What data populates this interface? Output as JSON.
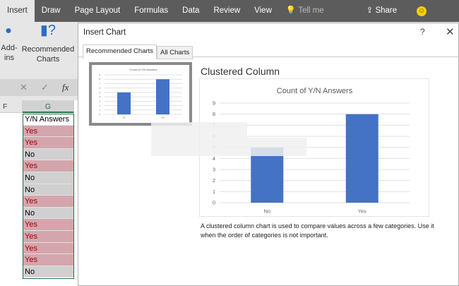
{
  "ribbon_tabs": [
    "Insert",
    "Draw",
    "Page Layout",
    "Formulas",
    "Data",
    "Review",
    "View"
  ],
  "tell_me": "Tell me",
  "share": "Share",
  "ribbon": {
    "addins": "Add-ins",
    "recommended": "Recommended Charts"
  },
  "formula_bar": {
    "cancel": "✕",
    "enter": "✓",
    "fx": "fx"
  },
  "sheet": {
    "columns": [
      "F",
      "G"
    ],
    "header": "Y/N Answers",
    "values": [
      "Yes",
      "Yes",
      "No",
      "Yes",
      "No",
      "No",
      "Yes",
      "No",
      "Yes",
      "Yes",
      "Yes",
      "Yes",
      "No"
    ]
  },
  "dialog": {
    "title": "Insert Chart",
    "help": "?",
    "close": "✕",
    "tabs": [
      "Recommended Charts",
      "All Charts"
    ],
    "chart_type": "Clustered Column",
    "description": "A clustered column chart is used to compare values across a few categories. Use it when the order of categories is not important."
  },
  "colors": {
    "bar": "#4472c4",
    "yes_fill": "#d4a5ad",
    "yes_text": "#9c0006"
  },
  "chart_data": {
    "type": "bar",
    "title": "Count of Y/N Answers",
    "categories": [
      "No",
      "Yes"
    ],
    "values": [
      5,
      8
    ],
    "ylim": [
      0,
      9
    ],
    "yticks": [
      0,
      1,
      2,
      3,
      4,
      5,
      6,
      7,
      8,
      9
    ],
    "grid": true
  }
}
